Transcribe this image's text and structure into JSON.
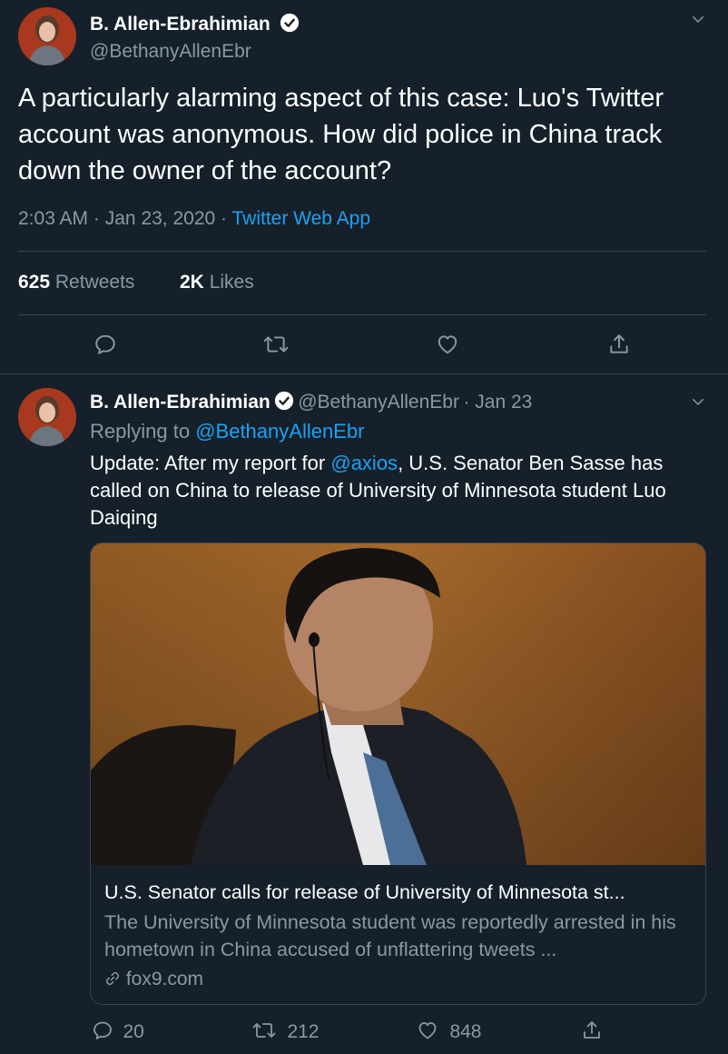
{
  "main_tweet": {
    "author_name": "B. Allen-Ebrahimian",
    "author_handle": "@BethanyAllenEbr",
    "text": "A particularly alarming aspect of this case: Luo's Twitter account was anonymous. How did police in China track down the owner of the account?",
    "time": "2:03 AM",
    "date": "Jan 23, 2020",
    "separator": "·",
    "source": "Twitter Web App",
    "retweets_count": "625",
    "retweets_label": "Retweets",
    "likes_count": "2K",
    "likes_label": "Likes"
  },
  "reply_tweet": {
    "author_name": "B. Allen-Ebrahimian",
    "author_handle": "@BethanyAllenEbr",
    "date": "· Jan 23",
    "replying_prefix": "Replying to",
    "replying_to": "@BethanyAllenEbr",
    "text_part1": "Update: After my report for",
    "mention": "@axios",
    "text_part2": ", U.S. Senator Ben Sasse has called on China to release of University of Minnesota student Luo Daiqing",
    "card": {
      "title": "U.S. Senator calls for release of University of Minnesota st...",
      "description": "The University of Minnesota student was reportedly arrested in his hometown in China accused of unflattering tweets ...",
      "domain": "fox9.com"
    },
    "reply_count": "20",
    "retweet_count": "212",
    "like_count": "848"
  },
  "colors": {
    "background": "#15202b",
    "accent": "#1da1f2",
    "secondary_text": "#8899a6",
    "divider": "#38444d"
  },
  "icons": [
    "verified-badge-icon",
    "chevron-down-icon",
    "reply-icon",
    "retweet-icon",
    "like-icon",
    "share-icon",
    "link-icon"
  ]
}
